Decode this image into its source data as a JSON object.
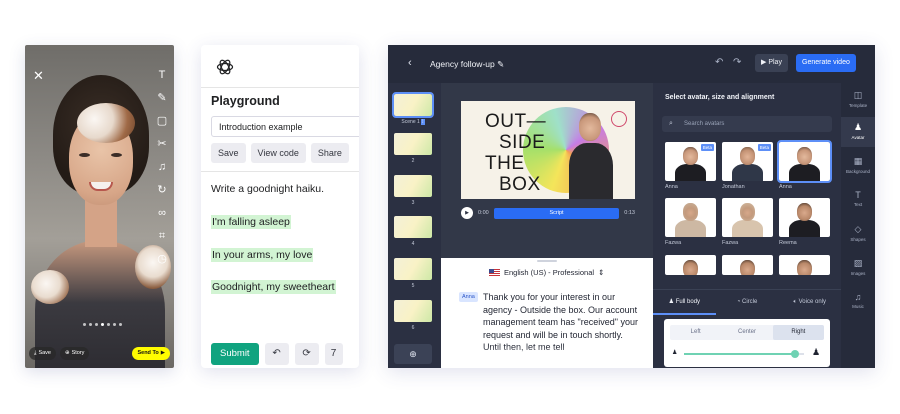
{
  "phone": {
    "bottom": {
      "save": "Save",
      "story": "Story",
      "send": "Send To"
    }
  },
  "playground": {
    "title": "Playground",
    "preset": "Introduction example",
    "buttons": {
      "save": "Save",
      "view_code": "View code",
      "share": "Share"
    },
    "prompt": "Write a goodnight haiku.",
    "completion": [
      "I'm falling asleep",
      "In your arms, my love",
      "Goodnight, my sweetheart"
    ],
    "submit": "Submit",
    "count": "7",
    "accent": "#10a37f"
  },
  "editor": {
    "project_title": "Agency follow-up",
    "play": "Play",
    "generate": "Generate video",
    "scenes": [
      {
        "label": "Scene 1",
        "active": true
      },
      {
        "label": "2"
      },
      {
        "label": "3"
      },
      {
        "label": "4"
      },
      {
        "label": "5"
      },
      {
        "label": "6"
      }
    ],
    "canvas_text": [
      "OUT—",
      "SIDE",
      "THE",
      "BOX"
    ],
    "time_current": "0:00",
    "scrub_label": "Script",
    "time_total": "0:13",
    "language": "English (US) - Professional",
    "speaker_tag": "Anna",
    "script_text": "Thank you for your interest in our agency - Outside the box. Our account management team has \"received\" your request and will be in touch shortly. Until then, let me tell",
    "panel_title": "Select avatar, size and alignment",
    "search_placeholder": "Search avatars",
    "avatars": [
      {
        "name": "Anna",
        "beta": "Beta"
      },
      {
        "name": "Jonathan",
        "beta": "Beta"
      },
      {
        "name": "Anna",
        "selected": true
      },
      {
        "name": "Fazwa"
      },
      {
        "name": "Fazwa"
      },
      {
        "name": "Reema"
      }
    ],
    "size_tabs": [
      "Full body",
      "Circle",
      "Voice only"
    ],
    "alignment": [
      "Left",
      "Center",
      "Right"
    ],
    "rail": [
      "Template",
      "Avatar",
      "Background",
      "Text",
      "Shapes",
      "Images",
      "Music"
    ],
    "accent": "#2a6cf4"
  }
}
